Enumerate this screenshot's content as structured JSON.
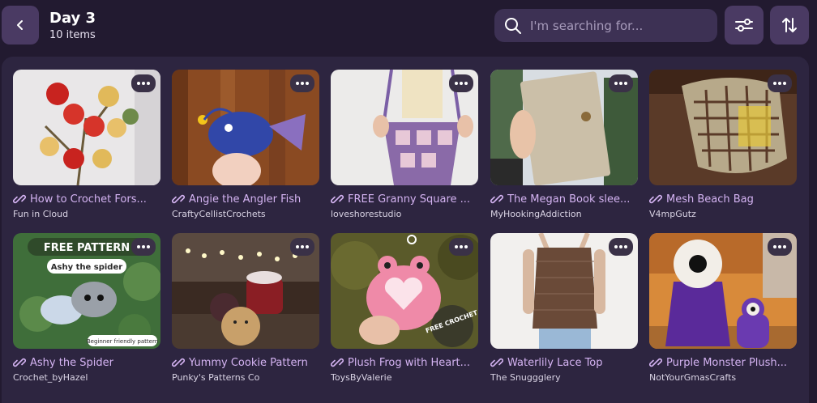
{
  "header": {
    "title": "Day 3",
    "subtitle": "10 items",
    "back_icon": "chevron-left-icon",
    "filter_icon": "sliders-icon",
    "sort_icon": "sort-arrows-icon"
  },
  "search": {
    "placeholder": "I'm searching for...",
    "value": ""
  },
  "colors": {
    "background": "#221a30",
    "panel": "#2d2540",
    "button": "#4a3a63",
    "title_link": "#d4b3f2"
  },
  "cards": [
    {
      "title": "How to Crochet Fors...",
      "author": "Fun in Cloud"
    },
    {
      "title": "Angie the Angler Fish",
      "author": "CraftyCellistCrochets"
    },
    {
      "title": "FREE Granny Square ...",
      "author": "loveshorestudio"
    },
    {
      "title": "The Megan Book slee...",
      "author": "MyHookingAddiction"
    },
    {
      "title": "Mesh Beach Bag",
      "author": "V4mpGutz"
    },
    {
      "title": "Ashy the Spider",
      "author": "Crochet_byHazel",
      "image_text": [
        "FREE PATTERN",
        "Ashy the spider",
        "Beginner friendly pattern"
      ]
    },
    {
      "title": "Yummy Cookie Pattern",
      "author": "Punky's Patterns Co"
    },
    {
      "title": "Plush Frog with Heart...",
      "author": "ToysByValerie",
      "image_text": [
        "FREE CROCHET"
      ]
    },
    {
      "title": "Waterlily Lace Top",
      "author": "The Snuggglery"
    },
    {
      "title": "Purple Monster Plush...",
      "author": "NotYourGmasCrafts"
    }
  ]
}
